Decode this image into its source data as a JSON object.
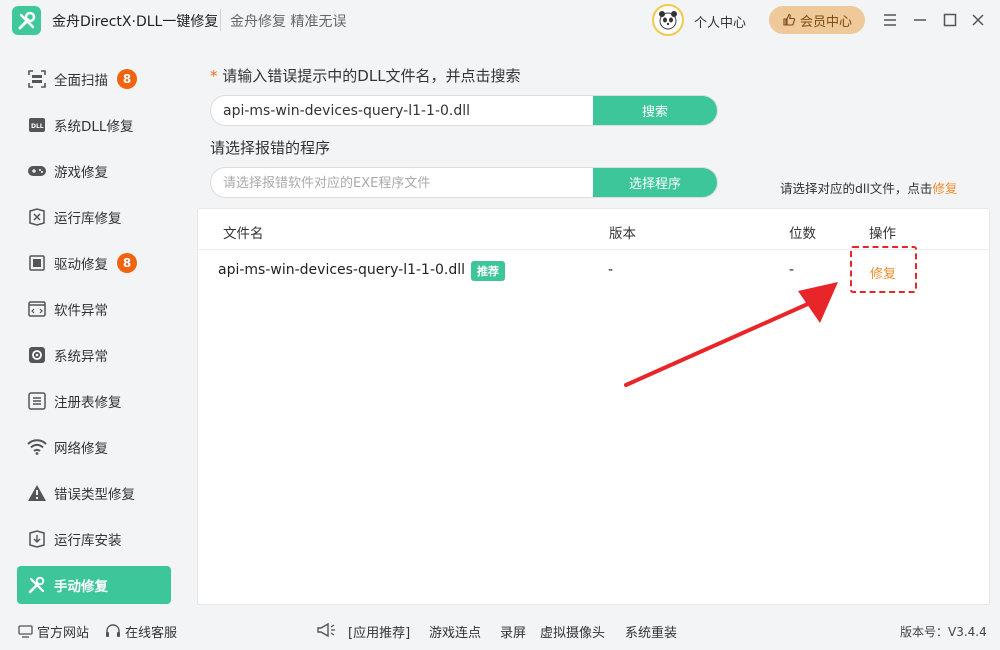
{
  "titlebar": {
    "app_title": "金舟DirectX·DLL一键修复",
    "slogan": "金舟修复 精准无误",
    "user_center": "个人中心",
    "vip_button": "会员中心",
    "window_controls": [
      "menu-icon",
      "minimize-icon",
      "maximize-icon",
      "close-icon"
    ]
  },
  "sidebar": {
    "items": [
      {
        "label": "全面扫描",
        "badge": "8",
        "icon": "scan-icon"
      },
      {
        "label": "系统DLL修复",
        "badge": "",
        "icon": "dll-icon"
      },
      {
        "label": "游戏修复",
        "badge": "",
        "icon": "gamepad-icon"
      },
      {
        "label": "运行库修复",
        "badge": "",
        "icon": "runtime-icon"
      },
      {
        "label": "驱动修复",
        "badge": "8",
        "icon": "driver-icon"
      },
      {
        "label": "软件异常",
        "badge": "",
        "icon": "code-window-icon"
      },
      {
        "label": "系统异常",
        "badge": "",
        "icon": "gear-icon"
      },
      {
        "label": "注册表修复",
        "badge": "",
        "icon": "list-icon"
      },
      {
        "label": "网络修复",
        "badge": "",
        "icon": "wifi-icon"
      },
      {
        "label": "错误类型修复",
        "badge": "",
        "icon": "warning-icon"
      },
      {
        "label": "运行库安装",
        "badge": "",
        "icon": "runtime-install-icon"
      },
      {
        "label": "手动修复",
        "badge": "",
        "icon": "tools-icon",
        "active": true
      }
    ]
  },
  "search": {
    "label_star": "*",
    "label": "请输入错误提示中的DLL文件名，并点击搜索",
    "value": "api-ms-win-devices-query-l1-1-0.dll",
    "button": "搜索"
  },
  "program": {
    "label": "请选择报错的程序",
    "placeholder": "请选择报错软件对应的EXE程序文件",
    "button": "选择程序"
  },
  "hint": {
    "text": "请选择对应的dll文件，点击",
    "link": "修复"
  },
  "table": {
    "columns": [
      "文件名",
      "版本",
      "位数",
      "操作"
    ],
    "rows": [
      {
        "filename": "api-ms-win-devices-query-l1-1-0.dll",
        "tag": "推荐",
        "version": "-",
        "bits": "-",
        "action": "修复"
      }
    ]
  },
  "bottom": {
    "official_site": "官方网站",
    "online_service": "在线客服",
    "recommend_label": "[应用推荐]",
    "links": [
      "游戏连点",
      "录屏",
      "虚拟摄像头",
      "系统重装"
    ],
    "version": "版本号：V3.4.4"
  },
  "colors": {
    "accent_green": "#3cc69a",
    "badge_orange": "#f2630f",
    "link_orange": "#f08c2c",
    "annotation_red": "#e8262a"
  }
}
